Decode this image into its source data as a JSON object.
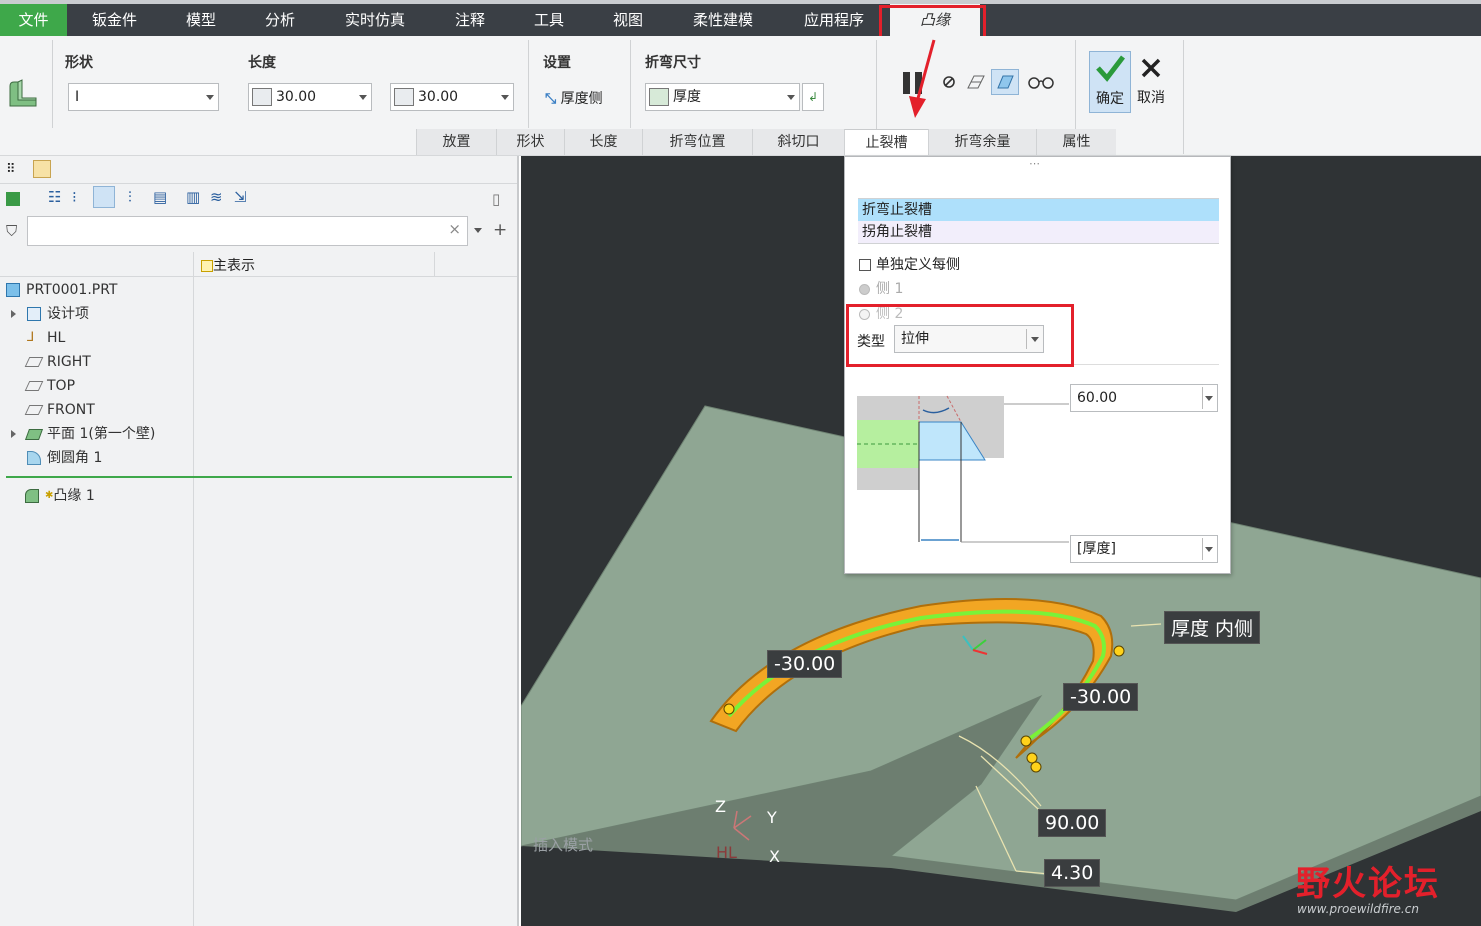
{
  "menu": {
    "tabs": [
      "文件",
      "钣金件",
      "模型",
      "分析",
      "实时仿真",
      "注释",
      "工具",
      "视图",
      "柔性建模",
      "应用程序",
      "凸缘"
    ],
    "active_tab": "凸缘"
  },
  "ribbon": {
    "shape": {
      "label": "形状",
      "value": "I"
    },
    "length": {
      "label": "长度",
      "value1": "30.00",
      "value2": "30.00"
    },
    "settings": {
      "label": "设置",
      "thickness_side": "厚度侧"
    },
    "bend_dimension": {
      "label": "折弯尺寸",
      "value": "厚度"
    },
    "ok_label": "确定",
    "cancel_label": "取消",
    "sub_tabs": [
      "放置",
      "形状",
      "长度",
      "折弯位置",
      "斜切口",
      "止裂槽",
      "折弯余量",
      "属性"
    ],
    "active_sub_tab": "止裂槽"
  },
  "tree": {
    "column_header": "主表示",
    "items": [
      {
        "label": "PRT0001.PRT",
        "icon": "part-icon"
      },
      {
        "label": "设计项",
        "icon": "design-items-icon",
        "expandable": true
      },
      {
        "label": "HL",
        "icon": "csys-icon"
      },
      {
        "label": "RIGHT",
        "icon": "datum-plane-icon"
      },
      {
        "label": "TOP",
        "icon": "datum-plane-icon"
      },
      {
        "label": "FRONT",
        "icon": "datum-plane-icon"
      },
      {
        "label": "平面 1(第一个壁)",
        "icon": "planar-wall-icon",
        "expandable": true
      },
      {
        "label": "倒圆角 1",
        "icon": "round-icon"
      }
    ],
    "insert_item": {
      "label": "凸缘 1",
      "icon": "flange-icon"
    }
  },
  "relief_panel": {
    "list": [
      "折弯止裂槽",
      "拐角止裂槽"
    ],
    "selected_index": 0,
    "checkbox_label": "单独定义每侧",
    "side1": "侧 1",
    "side2": "侧 2",
    "type_label": "类型",
    "type_value": "拉伸",
    "angle_value": "60.00",
    "width_value": "[厚度]"
  },
  "viewport": {
    "insert_mode": "插入模式",
    "dim_tags": [
      "-30.00",
      "-30.00",
      "90.00",
      "4.30"
    ],
    "thickness_tag": "厚度 内侧",
    "axes": {
      "z": "Z",
      "y": "Y",
      "x": "X",
      "hl": "HL"
    },
    "watermark_text": "野火论坛",
    "watermark_url": "www.proewildfire.cn"
  },
  "colors": {
    "menubar": "#3a3f45",
    "file_tab": "#3ea84a",
    "highlight_red": "#e3202b",
    "viewport_bg": "#2f3335",
    "sheet": "#8fa693",
    "flange": "#f2a623"
  }
}
